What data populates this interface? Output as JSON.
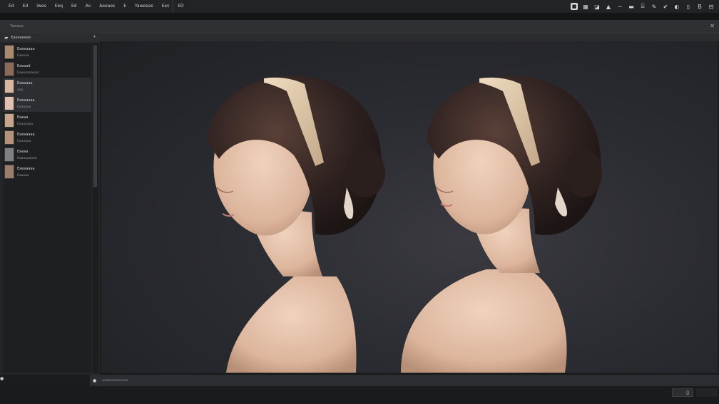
{
  "menubar": {
    "items": [
      "Ed",
      "Ed",
      "Iwes",
      "Eeq",
      "Ed",
      "Ao",
      "Aeeaes",
      "E",
      "Yaweeas",
      "Ees",
      "ED"
    ]
  },
  "toolbar": {
    "icons": [
      "square-icon",
      "grid-icon",
      "flag-icon",
      "mountain-icon",
      "minus-icon",
      "dash-icon",
      "doc-icon",
      "brush-icon",
      "check-icon",
      "palette-icon",
      "phone-icon",
      "bold-icon",
      "layout-icon"
    ],
    "glyphs": [
      "■",
      "▦",
      "◪",
      "▲",
      "−",
      "▬",
      "⌸",
      "✎",
      "✔",
      "◐",
      "▯",
      "B",
      "⊟"
    ]
  },
  "subbar": {
    "title": "Yaeeas",
    "close": "✕"
  },
  "panel": {
    "title": "Eaeeaeeee",
    "assets": [
      {
        "name": "Eaeeaaaa",
        "meta": "Eaeeaa",
        "color": "#a98a6e"
      },
      {
        "name": "Eaeaad",
        "meta": "Eaeeaaaaaaa",
        "color": "#8b6a58"
      },
      {
        "name": "Eaeaaaa",
        "meta": "aaa",
        "color": "#d9b6a0"
      },
      {
        "name": "Eaeaaaaa",
        "meta": "Eaaaaaa",
        "color": "#e2c2ae"
      },
      {
        "name": "Eaeaa",
        "meta": "Eaaaaaaa",
        "color": "#c9a58e"
      },
      {
        "name": "Eaeaaaaa",
        "meta": "Eaaaaaa",
        "color": "#b6927a"
      },
      {
        "name": "Eaeaa",
        "meta": "Eaaaaaaaaa",
        "color": "#7f8084"
      },
      {
        "name": "Eaeaaaaa",
        "meta": "Eaaaaa",
        "color": "#9b7d6c"
      }
    ]
  },
  "statusbar": {
    "text": "aaaaaaaaaaaaa"
  },
  "footbar": {
    "button": "▯"
  },
  "colors": {
    "skin": "#e6c3ab",
    "hair": "#3a2a25",
    "headband": "#d9c1a0",
    "background": "#2b2c31"
  }
}
